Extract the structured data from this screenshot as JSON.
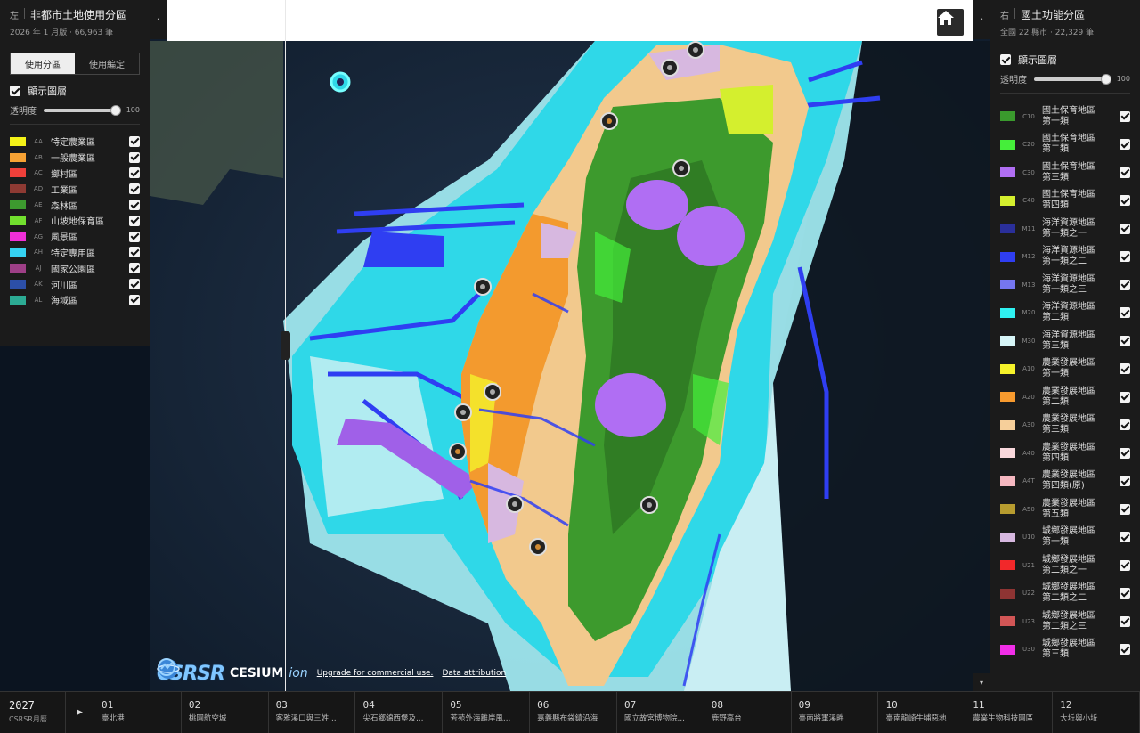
{
  "left_panel": {
    "side": "左",
    "title": "非都市土地使用分區",
    "subtitle": "2026 年 1 月版 · 66,963 筆",
    "tabs": [
      "使用分區",
      "使用編定"
    ],
    "active_tab": 0,
    "show_layer_label": "顯示圖層",
    "opacity_label": "透明度",
    "opacity_value": "100",
    "legend": [
      {
        "code": "AA",
        "label": "特定農業區",
        "color": "#f4f218",
        "checked": true
      },
      {
        "code": "AB",
        "label": "一般農業區",
        "color": "#f7a234",
        "checked": true
      },
      {
        "code": "AC",
        "label": "鄉村區",
        "color": "#f0403a",
        "checked": true
      },
      {
        "code": "AD",
        "label": "工業區",
        "color": "#8e3a33",
        "checked": true
      },
      {
        "code": "AE",
        "label": "森林區",
        "color": "#3d9a2f",
        "checked": true
      },
      {
        "code": "AF",
        "label": "山坡地保育區",
        "color": "#72e02e",
        "checked": true
      },
      {
        "code": "AG",
        "label": "風景區",
        "color": "#f02fd8",
        "checked": true
      },
      {
        "code": "AH",
        "label": "特定專用區",
        "color": "#35d2f2",
        "checked": true
      },
      {
        "code": "AJ",
        "label": "國家公園區",
        "color": "#9e3f87",
        "checked": true
      },
      {
        "code": "AK",
        "label": "河川區",
        "color": "#2c4fa8",
        "checked": true
      },
      {
        "code": "AL",
        "label": "海域區",
        "color": "#2cab94",
        "checked": true
      }
    ]
  },
  "right_panel": {
    "side": "右",
    "title": "國土功能分區",
    "subtitle": "全國 22 縣市 · 22,329 筆",
    "show_layer_label": "顯示圖層",
    "opacity_label": "透明度",
    "opacity_value": "100",
    "legend": [
      {
        "code": "C10",
        "line1": "國土保育地區",
        "line2": "第一類",
        "color": "#3a9a2d",
        "checked": true
      },
      {
        "code": "C20",
        "line1": "國土保育地區",
        "line2": "第二類",
        "color": "#45ee3a",
        "checked": true
      },
      {
        "code": "C30",
        "line1": "國土保育地區",
        "line2": "第三類",
        "color": "#b06ef3",
        "checked": true
      },
      {
        "code": "C40",
        "line1": "國土保育地區",
        "line2": "第四類",
        "color": "#d4ef2e",
        "checked": true
      },
      {
        "code": "M11",
        "line1": "海洋資源地區",
        "line2": "第一類之一",
        "color": "#2a2f9a",
        "checked": true
      },
      {
        "code": "M12",
        "line1": "海洋資源地區",
        "line2": "第一類之二",
        "color": "#2f3ef2",
        "checked": true
      },
      {
        "code": "M13",
        "line1": "海洋資源地區",
        "line2": "第一類之三",
        "color": "#7576f0",
        "checked": true
      },
      {
        "code": "M20",
        "line1": "海洋資源地區",
        "line2": "第二類",
        "color": "#2ff1f1",
        "checked": true
      },
      {
        "code": "M30",
        "line1": "海洋資源地區",
        "line2": "第三類",
        "color": "#d6f5f7",
        "checked": true
      },
      {
        "code": "A10",
        "line1": "農業發展地區",
        "line2": "第一類",
        "color": "#f6f22a",
        "checked": true
      },
      {
        "code": "A20",
        "line1": "農業發展地區",
        "line2": "第二類",
        "color": "#f79a2e",
        "checked": true
      },
      {
        "code": "A30",
        "line1": "農業發展地區",
        "line2": "第三類",
        "color": "#f6cf9a",
        "checked": true
      },
      {
        "code": "A40",
        "line1": "農業發展地區",
        "line2": "第四類",
        "color": "#f9d8dc",
        "checked": true
      },
      {
        "code": "A4T",
        "line1": "農業發展地區",
        "line2": "第四類(原)",
        "color": "#f5b7c0",
        "checked": true
      },
      {
        "code": "A50",
        "line1": "農業發展地區",
        "line2": "第五類",
        "color": "#b79c2f",
        "checked": true
      },
      {
        "code": "U10",
        "line1": "城鄉發展地區",
        "line2": "第一類",
        "color": "#d7b8e0",
        "checked": true
      },
      {
        "code": "U21",
        "line1": "城鄉發展地區",
        "line2": "第二類之一",
        "color": "#f2282a",
        "checked": true
      },
      {
        "code": "U22",
        "line1": "城鄉發展地區",
        "line2": "第二類之二",
        "color": "#8e3433",
        "checked": true
      },
      {
        "code": "U23",
        "line1": "城鄉發展地區",
        "line2": "第二類之三",
        "color": "#d25656",
        "checked": true
      },
      {
        "code": "U30",
        "line1": "城鄉發展地區",
        "line2": "第三類",
        "color": "#f12ee8",
        "checked": true
      }
    ]
  },
  "map": {
    "home_icon": "home-icon",
    "collapse_left": "‹",
    "collapse_right": "›",
    "scroll_down": "▾",
    "credits": {
      "csrsr": "CSRSR",
      "cesium": "CESIUM",
      "ion": "ion",
      "upgrade": "Upgrade for commercial use.",
      "attribution": "Data attribution"
    }
  },
  "timeline": {
    "year": "2027",
    "subtitle": "CSRSR月曆",
    "play_icon": "▶",
    "months": [
      {
        "num": "01",
        "title": "臺北港"
      },
      {
        "num": "02",
        "title": "桃園航空城"
      },
      {
        "num": "03",
        "title": "客雅溪口與三姓…"
      },
      {
        "num": "04",
        "title": "尖石鄉錦西堡及…"
      },
      {
        "num": "05",
        "title": "芳苑外海離岸風…"
      },
      {
        "num": "06",
        "title": "嘉義縣布袋鎮沿海"
      },
      {
        "num": "07",
        "title": "國立故宮博物院…"
      },
      {
        "num": "08",
        "title": "鹿野高台"
      },
      {
        "num": "09",
        "title": "臺南將軍溪畔"
      },
      {
        "num": "10",
        "title": "臺南龍崎牛埔惡地"
      },
      {
        "num": "11",
        "title": "農業生物科技園區"
      },
      {
        "num": "12",
        "title": "大坵與小坵"
      }
    ]
  }
}
